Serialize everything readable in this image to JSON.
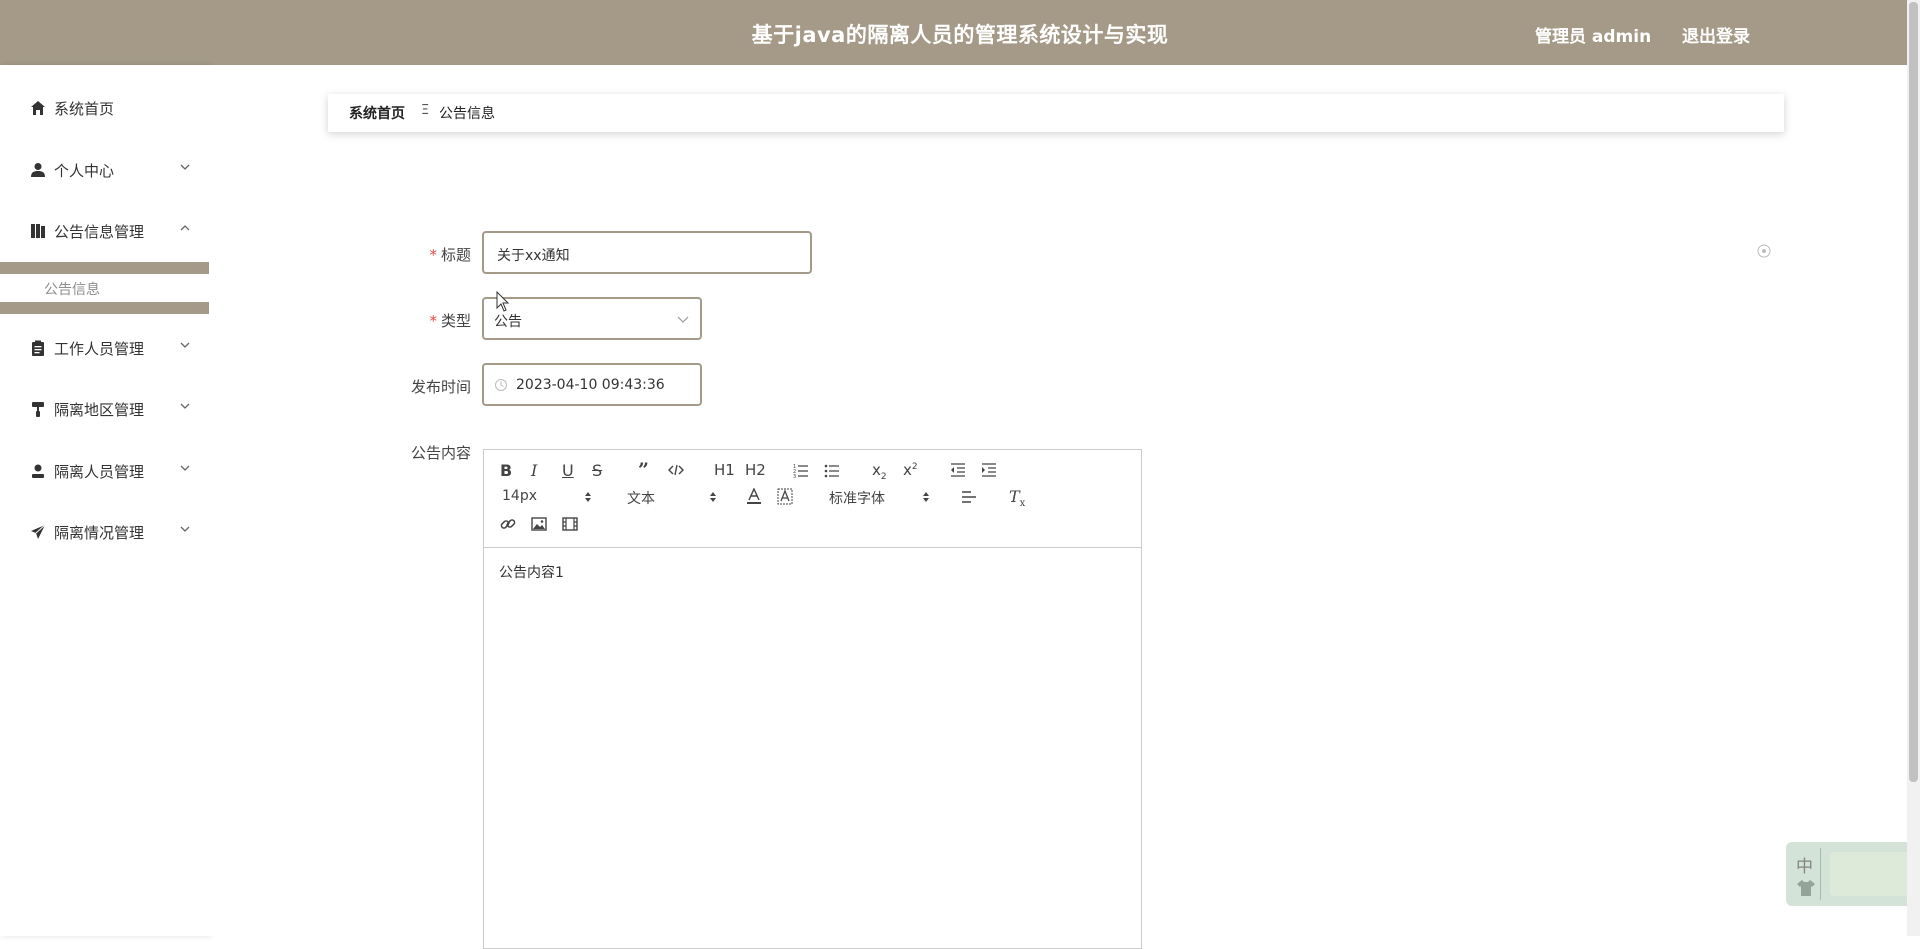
{
  "header": {
    "title": "基于java的隔离人员的管理系统设计与实现",
    "admin_label": "管理员 admin",
    "logout_label": "退出登录",
    "bg_color": "#a59a88"
  },
  "sidebar": {
    "items": [
      {
        "label": "系统首页",
        "icon": "home-icon"
      },
      {
        "label": "个人中心",
        "icon": "person-icon",
        "arrow": "chevron-down"
      },
      {
        "label": "公告信息管理",
        "icon": "book-icon",
        "arrow": "chevron-up"
      },
      {
        "label": "工作人员管理",
        "icon": "clipboard-icon",
        "arrow": "chevron-down"
      },
      {
        "label": "隔离地区管理",
        "icon": "paint-roller-icon",
        "arrow": "chevron-down"
      },
      {
        "label": "隔离人员管理",
        "icon": "user-icon",
        "arrow": "chevron-down"
      },
      {
        "label": "隔离情况管理",
        "icon": "paper-plane-icon",
        "arrow": "chevron-down"
      }
    ],
    "subitem": "公告信息"
  },
  "breadcrumb": {
    "home": "系统首页",
    "separator": "Ξ",
    "current": "公告信息"
  },
  "form": {
    "title_label": "标题",
    "title_value": "关于xx通知",
    "type_label": "类型",
    "type_value": "公告",
    "time_label": "发布时间",
    "time_value": "2023-04-10 09:43:36",
    "content_label": "公告内容",
    "required_mark": "*"
  },
  "editor": {
    "font_size": "14px",
    "paragraph": "文本",
    "font_family": "标准字体",
    "content": "公告内容1",
    "toolbar_labels": {
      "h1": "H1",
      "h2": "H2",
      "sub": "x",
      "sup": "x"
    }
  },
  "ime": {
    "mode_char": "中"
  }
}
